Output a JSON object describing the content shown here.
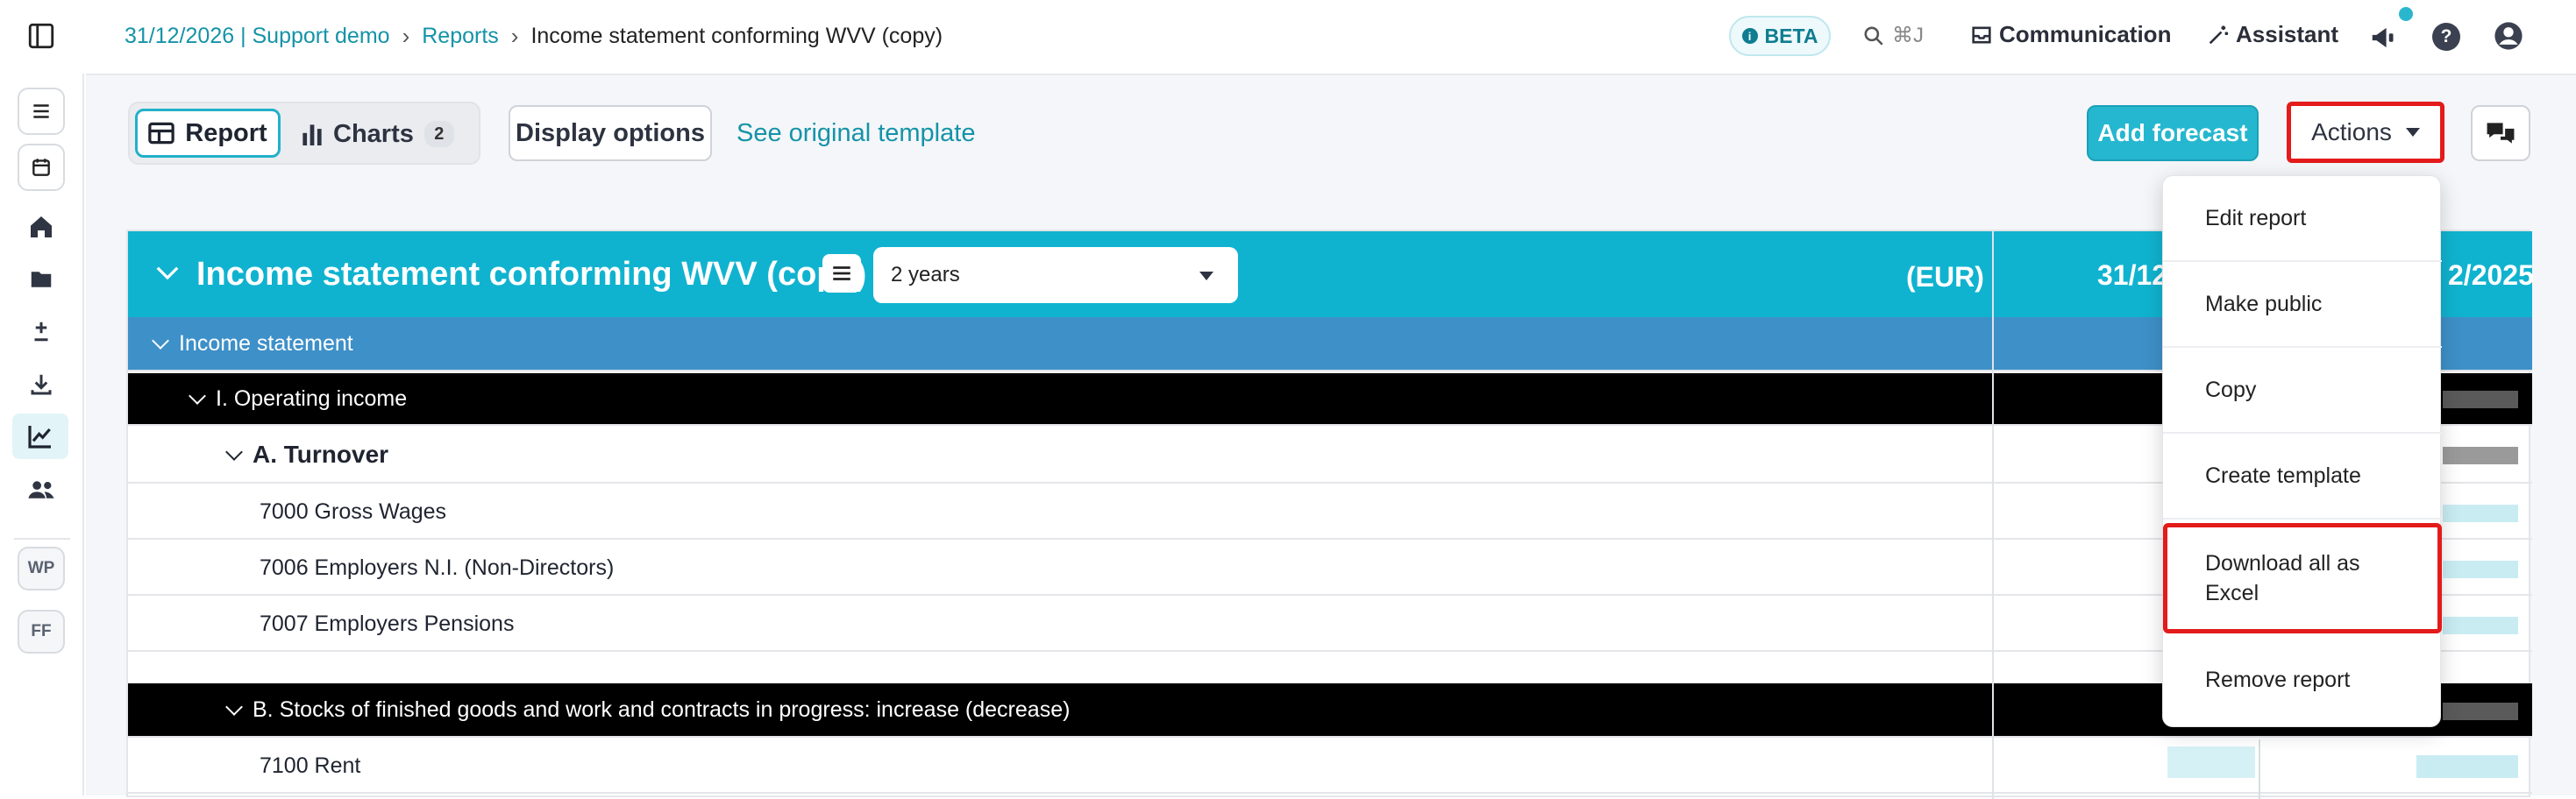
{
  "breadcrumb": {
    "company": "31/12/2026 | Support demo",
    "reports": "Reports",
    "current": "Income statement conforming WVV (copy)"
  },
  "header": {
    "beta": "BETA",
    "search_shortcut": "⌘J",
    "communication": "Communication",
    "assistant": "Assistant"
  },
  "rail": {
    "badge_wp": "WP",
    "badge_ff": "FF"
  },
  "toolbar": {
    "tab_report": "Report",
    "tab_charts": "Charts",
    "charts_count": "2",
    "display_options": "Display options",
    "see_template": "See original template",
    "add_forecast": "Add forecast",
    "actions": "Actions"
  },
  "report": {
    "title": "Income statement conforming WVV (copy)",
    "period": "2 years",
    "currency": "(EUR)",
    "col1_date": "31/12",
    "col2_date": "2/2025",
    "rows": [
      {
        "label": "Income statement",
        "type": "section"
      },
      {
        "label": "I. Operating income",
        "type": "black"
      },
      {
        "label": "A. Turnover",
        "type": "bold"
      },
      {
        "label": "7000 Gross Wages",
        "type": "normal"
      },
      {
        "label": "7006 Employers N.I. (Non-Directors)",
        "type": "normal"
      },
      {
        "label": "7007 Employers Pensions",
        "type": "normal"
      },
      {
        "label": "B. Stocks of finished goods and work and contracts in progress: increase (decrease)",
        "type": "black"
      },
      {
        "label": "7100 Rent",
        "type": "normal"
      }
    ]
  },
  "actions_menu": {
    "items": [
      "Edit report",
      "Make public",
      "Copy",
      "Create template",
      "Download all as Excel",
      "Remove report"
    ]
  },
  "colors": {
    "accent": "#10b3cf",
    "section": "#3e90c8",
    "highlight": "#e31b1b",
    "link": "#1593a8"
  }
}
